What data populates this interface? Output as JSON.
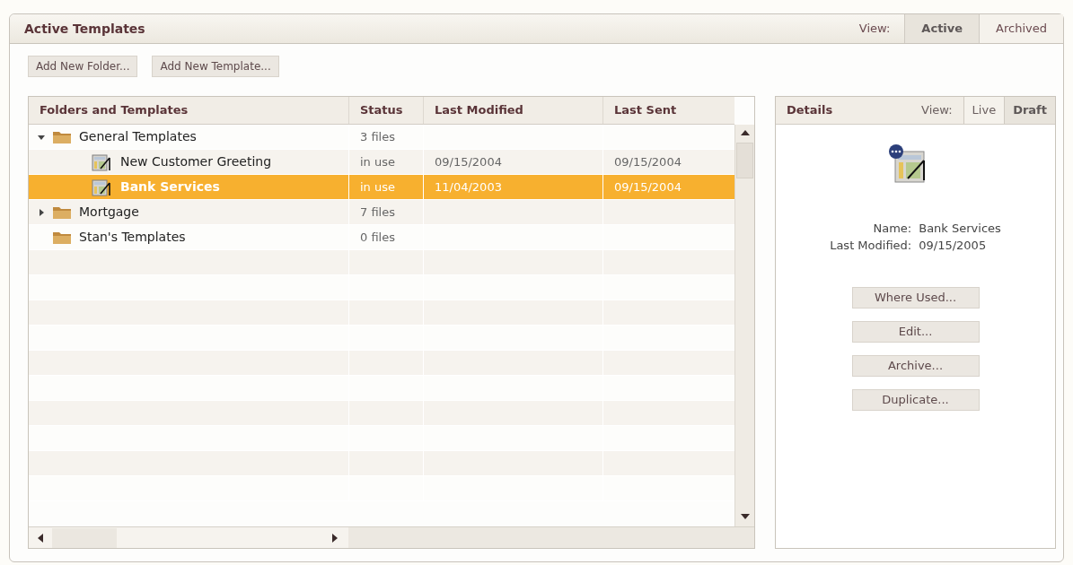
{
  "header": {
    "title": "Active Templates",
    "view_label": "View:",
    "tabs": [
      {
        "label": "Active",
        "selected": true
      },
      {
        "label": "Archived",
        "selected": false
      }
    ]
  },
  "toolbar": [
    "Add New Folder...",
    "Add New Template..."
  ],
  "table": {
    "columns": [
      "Folders and Templates",
      "Status",
      "Last Modified",
      "Last Sent"
    ],
    "rows": [
      {
        "kind": "folder",
        "name": "General Templates",
        "status": "3 files",
        "expanded": true,
        "selected": false,
        "children": [
          {
            "kind": "template",
            "name": "New Customer Greeting",
            "status": "in use",
            "last_modified": "09/15/2004",
            "last_sent": "09/15/2004",
            "selected": false
          },
          {
            "kind": "template",
            "name": "Bank Services",
            "status": "in use",
            "last_modified": "11/04/2003",
            "last_sent": "09/15/2004",
            "selected": true
          }
        ]
      },
      {
        "kind": "folder",
        "name": "Mortgage",
        "status": "7 files",
        "expanded": false,
        "selected": false
      },
      {
        "kind": "folder",
        "name": "Stan's Templates",
        "status": "0 files",
        "selected": false
      }
    ]
  },
  "details": {
    "title": "Details",
    "view_label": "View:",
    "tabs": [
      {
        "label": "Live",
        "selected": false
      },
      {
        "label": "Draft",
        "selected": true
      }
    ],
    "fields": [
      {
        "label": "Name:",
        "value": "Bank Services"
      },
      {
        "label": "Last Modified:",
        "value": "09/15/2005"
      }
    ],
    "buttons": [
      "Where Used...",
      "Edit...",
      "Archive...",
      "Duplicate..."
    ]
  }
}
